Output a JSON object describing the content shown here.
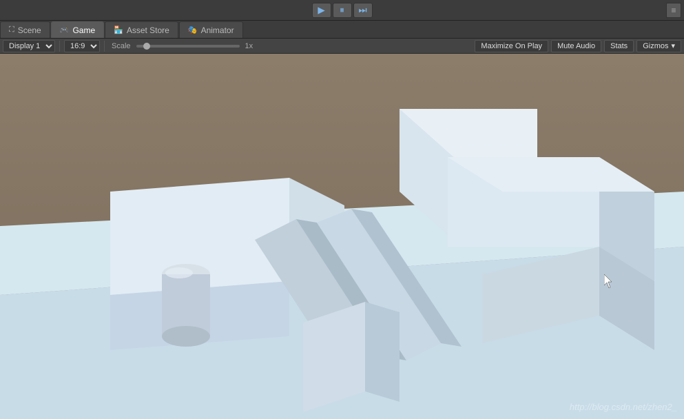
{
  "toolbar": {
    "play_label": "▶",
    "pause_label": "⏸",
    "step_label": "⏭",
    "collapse_label": "≡"
  },
  "tabs": [
    {
      "id": "scene",
      "label": "Scene",
      "icon": "🎬",
      "active": false
    },
    {
      "id": "game",
      "label": "Game",
      "icon": "🎮",
      "active": true
    },
    {
      "id": "asset-store",
      "label": "Asset Store",
      "icon": "🏪",
      "active": false
    },
    {
      "id": "animator",
      "label": "Animator",
      "icon": "🎭",
      "active": false
    }
  ],
  "options": {
    "display_label": "Display 1",
    "aspect_label": "16:9",
    "scale_label": "Scale",
    "scale_value": "1x",
    "maximize_on_play": "Maximize On Play",
    "mute_audio": "Mute Audio",
    "stats": "Stats",
    "gizmos": "Gizmos"
  },
  "watermark": "http://blog.csdn.net/zhen2_"
}
